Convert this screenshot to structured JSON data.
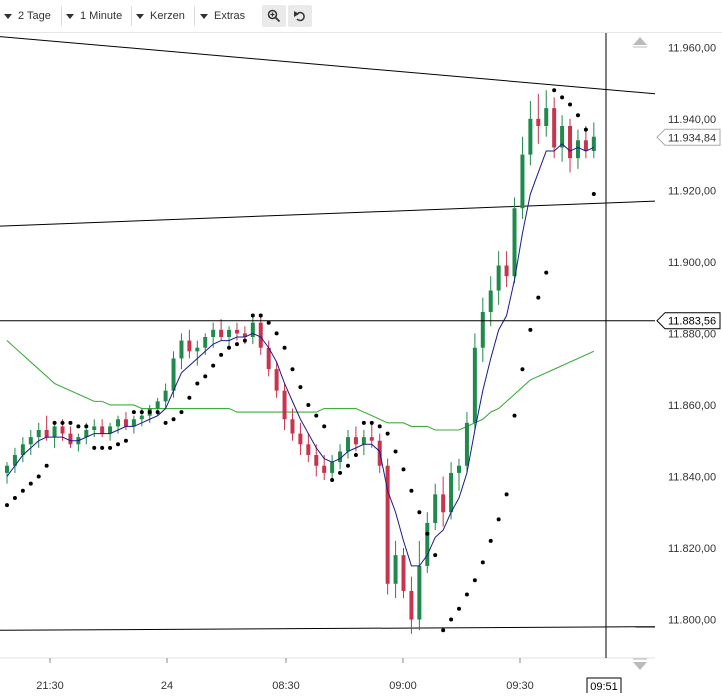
{
  "toolbar": {
    "period_label": "2 Tage",
    "interval_label": "1 Minute",
    "chart_type_label": "Kerzen",
    "extras_label": "Extras",
    "zoom_icon": "zoom-in-icon",
    "undo_icon": "undo-icon"
  },
  "chart_data": {
    "type": "candlestick",
    "y_axis": {
      "range": [
        11794,
        11964
      ],
      "ticks": [
        "11.960,00",
        "11.940,00",
        "11.920,00",
        "11.900,00",
        "11.880,00",
        "11.860,00",
        "11.840,00",
        "11.820,00",
        "11.800,00"
      ],
      "tick_values": [
        11960,
        11940,
        11920,
        11900,
        11880,
        11860,
        11840,
        11820,
        11800
      ]
    },
    "x_axis": {
      "labels": [
        "21:30",
        "24",
        "08:30",
        "09:00",
        "09:30"
      ],
      "crosshair_time": "09:51"
    },
    "price_labels": {
      "last_price": "11.934,84",
      "crosshair_price": "11.883,56"
    },
    "colors": {
      "up": "#1f8a4c",
      "down": "#c8334e",
      "ema_fast": "#1a1a8c",
      "sma_slow": "#3fae3f",
      "parabolic_sar": "#000000",
      "trendline": "#000000"
    },
    "candles": [
      {
        "o": 11841,
        "h": 11844,
        "l": 11838,
        "c": 11843
      },
      {
        "o": 11843,
        "h": 11848,
        "l": 11841,
        "c": 11846
      },
      {
        "o": 11846,
        "h": 11851,
        "l": 11844,
        "c": 11849
      },
      {
        "o": 11849,
        "h": 11853,
        "l": 11846,
        "c": 11851
      },
      {
        "o": 11851,
        "h": 11855,
        "l": 11848,
        "c": 11853
      },
      {
        "o": 11853,
        "h": 11857,
        "l": 11850,
        "c": 11851
      },
      {
        "o": 11851,
        "h": 11855,
        "l": 11848,
        "c": 11854
      },
      {
        "o": 11854,
        "h": 11856,
        "l": 11850,
        "c": 11852
      },
      {
        "o": 11852,
        "h": 11854,
        "l": 11848,
        "c": 11849
      },
      {
        "o": 11849,
        "h": 11852,
        "l": 11847,
        "c": 11851
      },
      {
        "o": 11851,
        "h": 11855,
        "l": 11849,
        "c": 11853
      },
      {
        "o": 11853,
        "h": 11856,
        "l": 11851,
        "c": 11854
      },
      {
        "o": 11854,
        "h": 11856,
        "l": 11851,
        "c": 11852
      },
      {
        "o": 11852,
        "h": 11855,
        "l": 11850,
        "c": 11854
      },
      {
        "o": 11854,
        "h": 11857,
        "l": 11852,
        "c": 11856
      },
      {
        "o": 11856,
        "h": 11858,
        "l": 11853,
        "c": 11854
      },
      {
        "o": 11854,
        "h": 11857,
        "l": 11852,
        "c": 11856
      },
      {
        "o": 11856,
        "h": 11859,
        "l": 11854,
        "c": 11857
      },
      {
        "o": 11857,
        "h": 11860,
        "l": 11855,
        "c": 11859
      },
      {
        "o": 11859,
        "h": 11862,
        "l": 11857,
        "c": 11861
      },
      {
        "o": 11861,
        "h": 11866,
        "l": 11859,
        "c": 11864
      },
      {
        "o": 11864,
        "h": 11875,
        "l": 11862,
        "c": 11873
      },
      {
        "o": 11873,
        "h": 11880,
        "l": 11870,
        "c": 11878
      },
      {
        "o": 11878,
        "h": 11881,
        "l": 11873,
        "c": 11875
      },
      {
        "o": 11875,
        "h": 11878,
        "l": 11871,
        "c": 11876
      },
      {
        "o": 11876,
        "h": 11880,
        "l": 11874,
        "c": 11879
      },
      {
        "o": 11879,
        "h": 11883,
        "l": 11876,
        "c": 11881
      },
      {
        "o": 11881,
        "h": 11884,
        "l": 11878,
        "c": 11879
      },
      {
        "o": 11879,
        "h": 11882,
        "l": 11876,
        "c": 11881
      },
      {
        "o": 11881,
        "h": 11883,
        "l": 11878,
        "c": 11880
      },
      {
        "o": 11880,
        "h": 11882,
        "l": 11877,
        "c": 11879
      },
      {
        "o": 11879,
        "h": 11885,
        "l": 11877,
        "c": 11883
      },
      {
        "o": 11883,
        "h": 11885,
        "l": 11874,
        "c": 11876
      },
      {
        "o": 11876,
        "h": 11878,
        "l": 11868,
        "c": 11870
      },
      {
        "o": 11870,
        "h": 11872,
        "l": 11862,
        "c": 11864
      },
      {
        "o": 11864,
        "h": 11866,
        "l": 11853,
        "c": 11856
      },
      {
        "o": 11856,
        "h": 11859,
        "l": 11850,
        "c": 11852
      },
      {
        "o": 11852,
        "h": 11855,
        "l": 11846,
        "c": 11849
      },
      {
        "o": 11849,
        "h": 11852,
        "l": 11844,
        "c": 11846
      },
      {
        "o": 11846,
        "h": 11849,
        "l": 11840,
        "c": 11843
      },
      {
        "o": 11843,
        "h": 11846,
        "l": 11839,
        "c": 11841
      },
      {
        "o": 11841,
        "h": 11846,
        "l": 11839,
        "c": 11844
      },
      {
        "o": 11844,
        "h": 11849,
        "l": 11842,
        "c": 11847
      },
      {
        "o": 11847,
        "h": 11853,
        "l": 11845,
        "c": 11851
      },
      {
        "o": 11851,
        "h": 11854,
        "l": 11847,
        "c": 11849
      },
      {
        "o": 11849,
        "h": 11853,
        "l": 11846,
        "c": 11851
      },
      {
        "o": 11851,
        "h": 11855,
        "l": 11848,
        "c": 11850
      },
      {
        "o": 11850,
        "h": 11852,
        "l": 11841,
        "c": 11843
      },
      {
        "o": 11843,
        "h": 11845,
        "l": 11807,
        "c": 11810
      },
      {
        "o": 11810,
        "h": 11822,
        "l": 11806,
        "c": 11818
      },
      {
        "o": 11818,
        "h": 11820,
        "l": 11806,
        "c": 11808
      },
      {
        "o": 11808,
        "h": 11812,
        "l": 11796,
        "c": 11800
      },
      {
        "o": 11800,
        "h": 11822,
        "l": 11797,
        "c": 11815
      },
      {
        "o": 11815,
        "h": 11830,
        "l": 11813,
        "c": 11827
      },
      {
        "o": 11827,
        "h": 11838,
        "l": 11825,
        "c": 11835
      },
      {
        "o": 11835,
        "h": 11840,
        "l": 11826,
        "c": 11830
      },
      {
        "o": 11830,
        "h": 11844,
        "l": 11828,
        "c": 11841
      },
      {
        "o": 11841,
        "h": 11845,
        "l": 11836,
        "c": 11843
      },
      {
        "o": 11843,
        "h": 11858,
        "l": 11841,
        "c": 11855
      },
      {
        "o": 11855,
        "h": 11880,
        "l": 11853,
        "c": 11876
      },
      {
        "o": 11876,
        "h": 11890,
        "l": 11872,
        "c": 11886
      },
      {
        "o": 11886,
        "h": 11896,
        "l": 11882,
        "c": 11892
      },
      {
        "o": 11892,
        "h": 11903,
        "l": 11888,
        "c": 11899
      },
      {
        "o": 11899,
        "h": 11903,
        "l": 11893,
        "c": 11896
      },
      {
        "o": 11896,
        "h": 11918,
        "l": 11894,
        "c": 11915
      },
      {
        "o": 11915,
        "h": 11935,
        "l": 11912,
        "c": 11930
      },
      {
        "o": 11930,
        "h": 11945,
        "l": 11927,
        "c": 11940
      },
      {
        "o": 11940,
        "h": 11947,
        "l": 11933,
        "c": 11938
      },
      {
        "o": 11938,
        "h": 11948,
        "l": 11935,
        "c": 11943
      },
      {
        "o": 11943,
        "h": 11946,
        "l": 11929,
        "c": 11932
      },
      {
        "o": 11932,
        "h": 11941,
        "l": 11928,
        "c": 11938
      },
      {
        "o": 11938,
        "h": 11940,
        "l": 11925,
        "c": 11929
      },
      {
        "o": 11929,
        "h": 11937,
        "l": 11926,
        "c": 11934
      },
      {
        "o": 11934,
        "h": 11938,
        "l": 11929,
        "c": 11931
      },
      {
        "o": 11931,
        "h": 11939,
        "l": 11929,
        "c": 11935
      }
    ],
    "ema_fast": [
      11840,
      11843,
      11846,
      11848,
      11850,
      11851,
      11851,
      11851,
      11850,
      11850,
      11851,
      11852,
      11852,
      11852,
      11853,
      11854,
      11854,
      11855,
      11856,
      11857,
      11859,
      11864,
      11869,
      11871,
      11873,
      11875,
      11877,
      11878,
      11878,
      11879,
      11879,
      11880,
      11879,
      11876,
      11872,
      11866,
      11861,
      11856,
      11852,
      11848,
      11845,
      11844,
      11845,
      11847,
      11848,
      11849,
      11849,
      11847,
      11836,
      11830,
      11822,
      11815,
      11815,
      11818,
      11823,
      11825,
      11830,
      11834,
      11841,
      11853,
      11864,
      11873,
      11881,
      11885,
      11895,
      11908,
      11919,
      11925,
      11931,
      11931,
      11933,
      11931,
      11932,
      11931,
      11932
    ],
    "sma_slow": [
      11878,
      11876,
      11874,
      11872,
      11870,
      11868,
      11866,
      11865,
      11864,
      11863,
      11862,
      11861,
      11861,
      11860,
      11860,
      11860,
      11860,
      11859,
      11859,
      11859,
      11859,
      11859,
      11859,
      11859,
      11859,
      11859,
      11859,
      11859,
      11859,
      11858,
      11858,
      11858,
      11858,
      11858,
      11858,
      11858,
      11858,
      11858,
      11858,
      11858,
      11859,
      11859,
      11859,
      11859,
      11859,
      11858,
      11857,
      11856,
      11855,
      11855,
      11855,
      11854,
      11854,
      11854,
      11853,
      11853,
      11853,
      11853,
      11854,
      11855,
      11856,
      11858,
      11859,
      11861,
      11863,
      11865,
      11867,
      11868,
      11869,
      11870,
      11871,
      11872,
      11873,
      11874,
      11875
    ],
    "psar": [
      11832,
      11834,
      11836,
      11838,
      11840,
      11843,
      11855,
      11855,
      11855,
      11854,
      11854,
      11848,
      11848,
      11848,
      11849,
      11850,
      11858,
      11858,
      11858,
      11858,
      11855,
      11856,
      11858,
      11862,
      11866,
      11868,
      11871,
      11874,
      11876,
      11877,
      11878,
      11885,
      11885,
      11883,
      11880,
      11876,
      11870,
      11865,
      11860,
      11857,
      11854,
      11839,
      11841,
      11843,
      11846,
      11855,
      11855,
      11854,
      11852,
      11847,
      11842,
      11836,
      11830,
      11824,
      11818,
      11797,
      11800,
      11803,
      11807,
      11811,
      11816,
      11822,
      11828,
      11835,
      11857,
      11870,
      11881,
      11890,
      11897,
      11948,
      11946,
      11944,
      11941,
      11937,
      11919
    ],
    "trendlines": [
      {
        "from": [
          0,
          11963
        ],
        "to": [
          74,
          11947
        ]
      },
      {
        "from": [
          0,
          11910
        ],
        "to": [
          74,
          11917
        ]
      },
      {
        "from": [
          0,
          11797
        ],
        "to": [
          74,
          11798
        ]
      }
    ],
    "crosshair": {
      "price": 11883.56
    }
  }
}
